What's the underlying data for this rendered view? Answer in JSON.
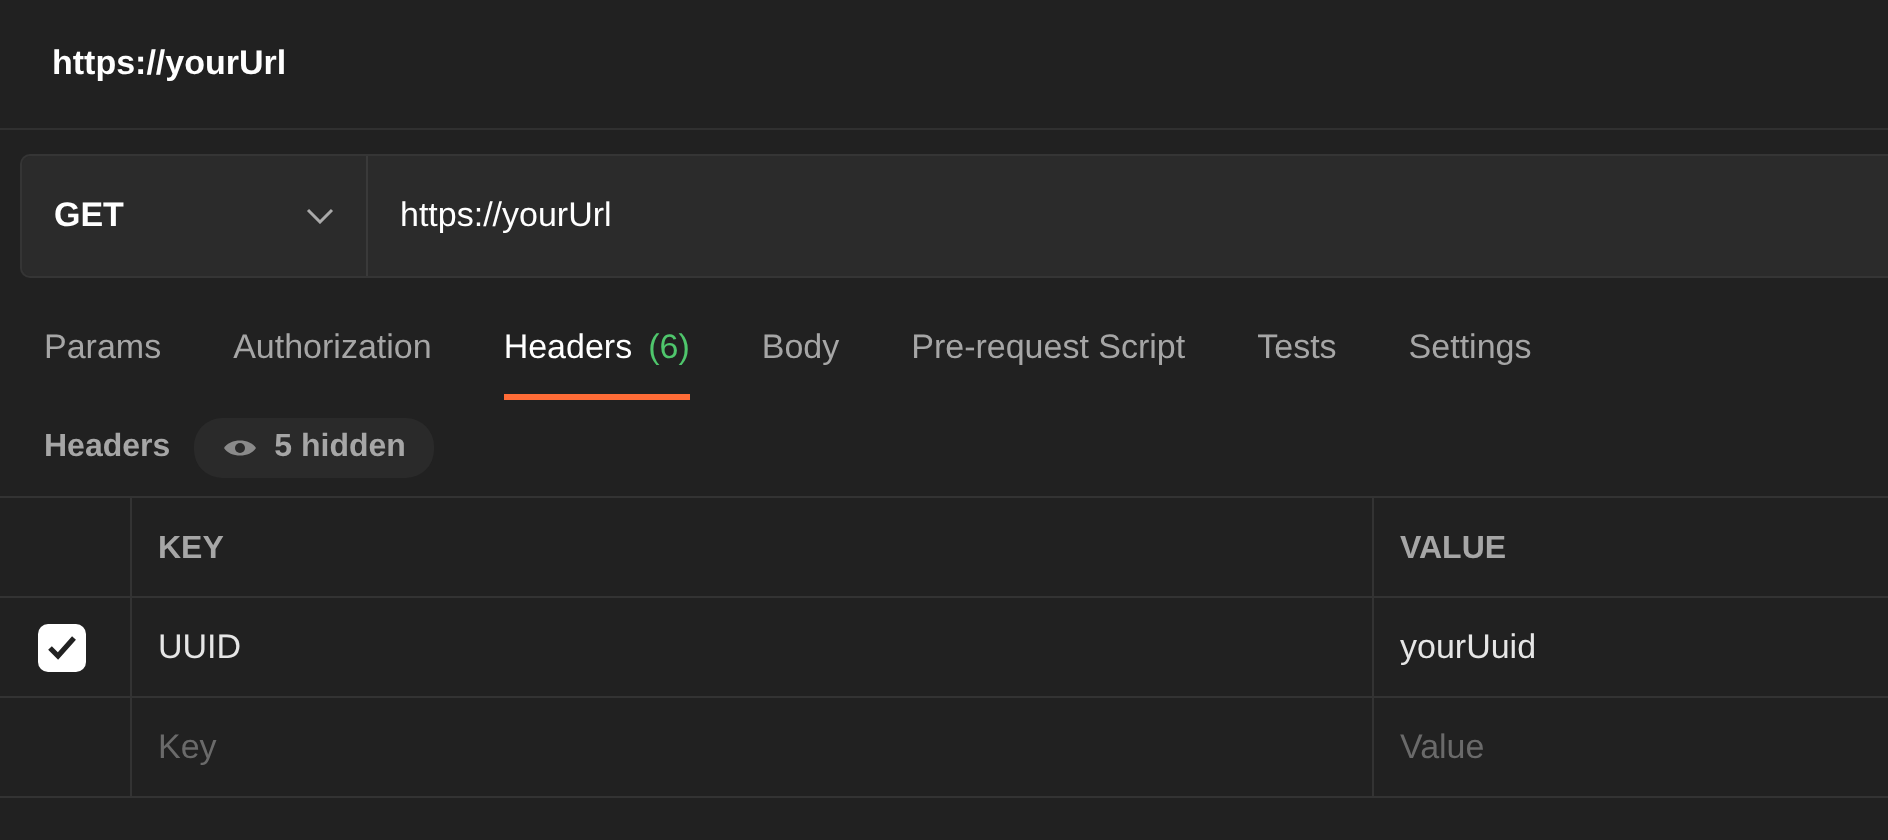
{
  "title": "https://yourUrl",
  "request": {
    "method": "GET",
    "url": "https://yourUrl"
  },
  "tabs": [
    {
      "label": "Params",
      "selected": false
    },
    {
      "label": "Authorization",
      "selected": false
    },
    {
      "label": "Headers",
      "count": "(6)",
      "selected": true
    },
    {
      "label": "Body",
      "selected": false
    },
    {
      "label": "Pre-request Script",
      "selected": false
    },
    {
      "label": "Tests",
      "selected": false
    },
    {
      "label": "Settings",
      "selected": false
    }
  ],
  "section": {
    "label": "Headers",
    "hidden_badge": "5 hidden"
  },
  "table": {
    "columns": [
      "KEY",
      "VALUE"
    ],
    "rows": [
      {
        "checked": true,
        "key": "UUID",
        "value": "yourUuid"
      }
    ],
    "new_row": {
      "key_placeholder": "Key",
      "value_placeholder": "Value"
    }
  }
}
